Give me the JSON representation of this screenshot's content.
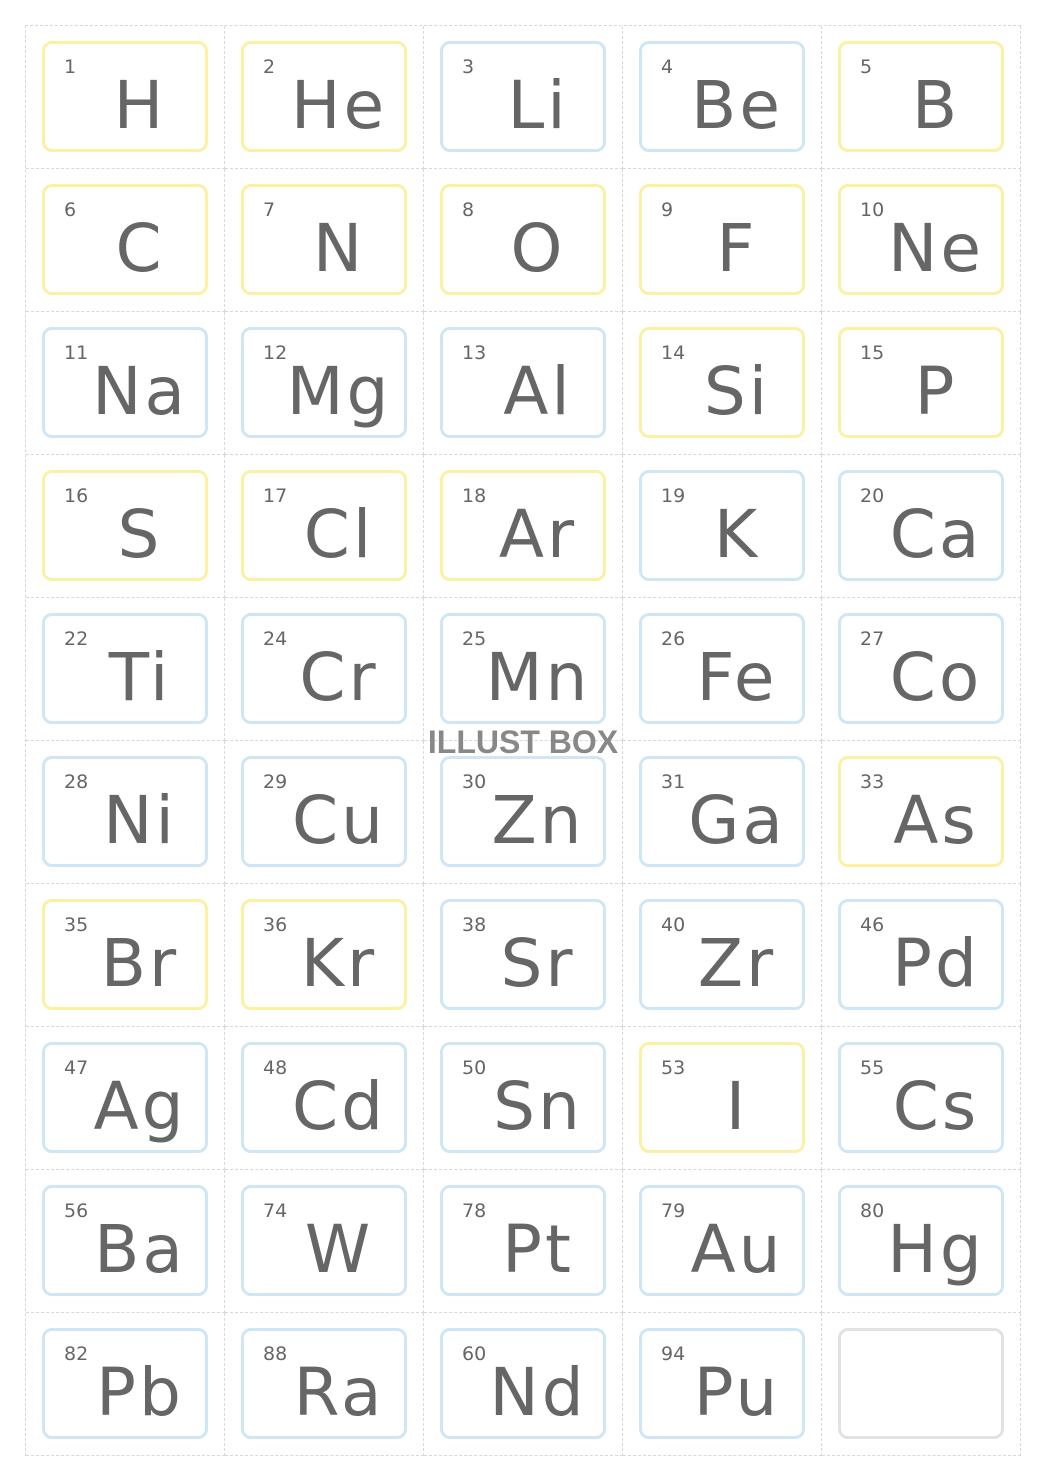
{
  "colors": {
    "yellow": "#fbf1a2",
    "blue": "#cfe6f5",
    "gray": "#e2e2e2",
    "text": "#666666"
  },
  "watermark": "ILLUST BOX",
  "elements": [
    {
      "n": "1",
      "s": "H",
      "c": "y"
    },
    {
      "n": "2",
      "s": "He",
      "c": "y"
    },
    {
      "n": "3",
      "s": "Li",
      "c": "b"
    },
    {
      "n": "4",
      "s": "Be",
      "c": "b"
    },
    {
      "n": "5",
      "s": "B",
      "c": "y"
    },
    {
      "n": "6",
      "s": "C",
      "c": "y"
    },
    {
      "n": "7",
      "s": "N",
      "c": "y"
    },
    {
      "n": "8",
      "s": "O",
      "c": "y"
    },
    {
      "n": "9",
      "s": "F",
      "c": "y"
    },
    {
      "n": "10",
      "s": "Ne",
      "c": "y"
    },
    {
      "n": "11",
      "s": "Na",
      "c": "b"
    },
    {
      "n": "12",
      "s": "Mg",
      "c": "b"
    },
    {
      "n": "13",
      "s": "Al",
      "c": "b"
    },
    {
      "n": "14",
      "s": "Si",
      "c": "y"
    },
    {
      "n": "15",
      "s": "P",
      "c": "y"
    },
    {
      "n": "16",
      "s": "S",
      "c": "y"
    },
    {
      "n": "17",
      "s": "Cl",
      "c": "y"
    },
    {
      "n": "18",
      "s": "Ar",
      "c": "y"
    },
    {
      "n": "19",
      "s": "K",
      "c": "b"
    },
    {
      "n": "20",
      "s": "Ca",
      "c": "b"
    },
    {
      "n": "22",
      "s": "Ti",
      "c": "b"
    },
    {
      "n": "24",
      "s": "Cr",
      "c": "b"
    },
    {
      "n": "25",
      "s": "Mn",
      "c": "b"
    },
    {
      "n": "26",
      "s": "Fe",
      "c": "b"
    },
    {
      "n": "27",
      "s": "Co",
      "c": "b"
    },
    {
      "n": "28",
      "s": "Ni",
      "c": "b"
    },
    {
      "n": "29",
      "s": "Cu",
      "c": "b"
    },
    {
      "n": "30",
      "s": "Zn",
      "c": "b"
    },
    {
      "n": "31",
      "s": "Ga",
      "c": "b"
    },
    {
      "n": "33",
      "s": "As",
      "c": "y"
    },
    {
      "n": "35",
      "s": "Br",
      "c": "y"
    },
    {
      "n": "36",
      "s": "Kr",
      "c": "y"
    },
    {
      "n": "38",
      "s": "Sr",
      "c": "b"
    },
    {
      "n": "40",
      "s": "Zr",
      "c": "b"
    },
    {
      "n": "46",
      "s": "Pd",
      "c": "b"
    },
    {
      "n": "47",
      "s": "Ag",
      "c": "b"
    },
    {
      "n": "48",
      "s": "Cd",
      "c": "b"
    },
    {
      "n": "50",
      "s": "Sn",
      "c": "b"
    },
    {
      "n": "53",
      "s": "I",
      "c": "y"
    },
    {
      "n": "55",
      "s": "Cs",
      "c": "b"
    },
    {
      "n": "56",
      "s": "Ba",
      "c": "b"
    },
    {
      "n": "74",
      "s": "W",
      "c": "b"
    },
    {
      "n": "78",
      "s": "Pt",
      "c": "b"
    },
    {
      "n": "79",
      "s": "Au",
      "c": "b"
    },
    {
      "n": "80",
      "s": "Hg",
      "c": "b"
    },
    {
      "n": "82",
      "s": "Pb",
      "c": "b"
    },
    {
      "n": "88",
      "s": "Ra",
      "c": "b"
    },
    {
      "n": "60",
      "s": "Nd",
      "c": "b"
    },
    {
      "n": "94",
      "s": "Pu",
      "c": "b"
    },
    {
      "n": "",
      "s": "",
      "c": "g"
    }
  ]
}
